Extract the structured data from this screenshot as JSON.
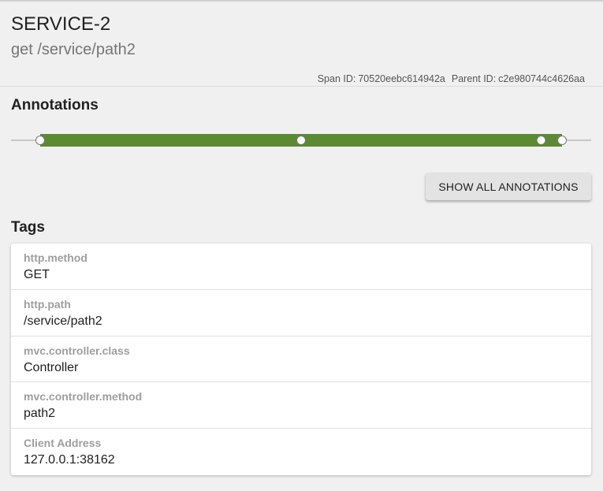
{
  "header": {
    "service_name": "SERVICE-2",
    "span_name": "get /service/path2",
    "span_id_label": "Span ID:",
    "span_id": "70520eebc614942a",
    "parent_id_label": "Parent ID:",
    "parent_id": "c2e980744c4626aa"
  },
  "annotations": {
    "title": "Annotations",
    "bar_color": "#5b8a32",
    "markers": [
      0.0,
      0.5,
      0.96,
      1.0
    ],
    "show_all_label": "SHOW ALL ANNOTATIONS"
  },
  "tags": {
    "title": "Tags",
    "items": [
      {
        "key": "http.method",
        "value": "GET"
      },
      {
        "key": "http.path",
        "value": "/service/path2"
      },
      {
        "key": "mvc.controller.class",
        "value": "Controller"
      },
      {
        "key": "mvc.controller.method",
        "value": "path2"
      },
      {
        "key": "Client Address",
        "value": "127.0.0.1:38162"
      }
    ]
  }
}
